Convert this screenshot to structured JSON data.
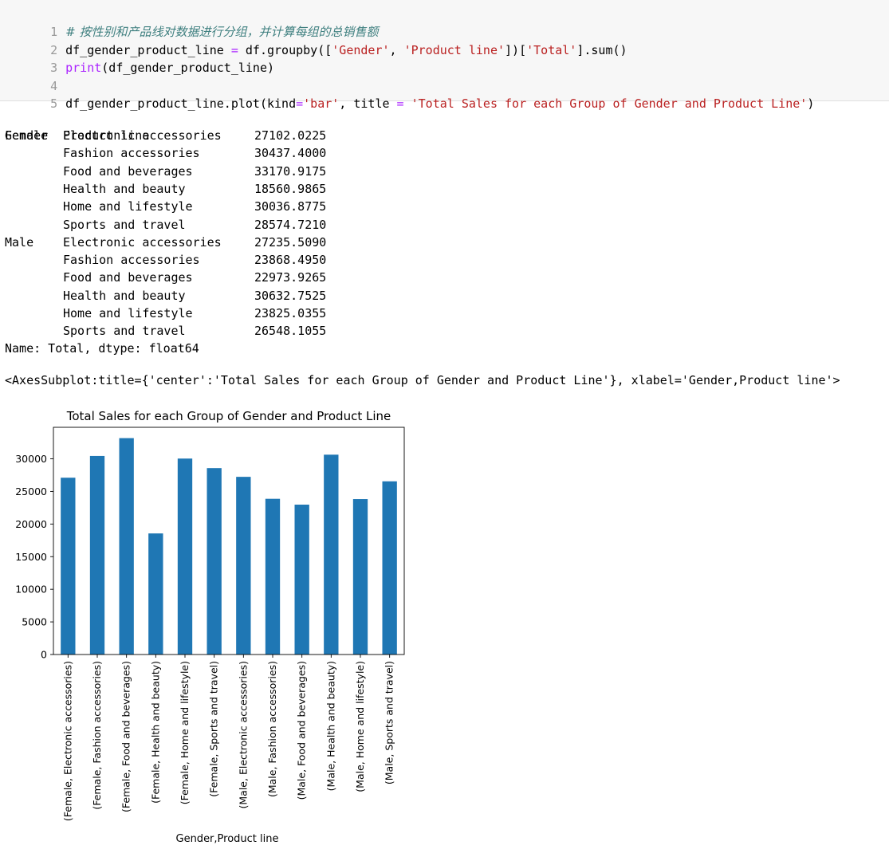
{
  "code_cell": {
    "line_numbers": [
      "1",
      "2",
      "3",
      "4",
      "5"
    ],
    "line1_comment": "# 按性别和产品线对数据进行分组，并计算每组的总销售额",
    "line2": {
      "a": "df_gender_product_line",
      "b": " = ",
      "c": "df.groupby([",
      "d": "'Gender'",
      "e": ", ",
      "f": "'Product line'",
      "g": "])[",
      "h": "'Total'",
      "i": "].sum()"
    },
    "line3": {
      "a": "print",
      "b": "(df_gender_product_line)"
    },
    "line5": {
      "a": "df_gender_product_line.plot(kind",
      "b": "=",
      "c": "'bar'",
      "d": ", title ",
      "e": "=",
      "f": " ",
      "g": "'Total Sales for each Group of Gender and Product Line'",
      "h": ")"
    }
  },
  "output": {
    "header_gender": "Gender",
    "header_product_line": "Product line",
    "rows": [
      {
        "gender": "Female",
        "product_line": "Electronic accessories",
        "value": "27102.0225"
      },
      {
        "gender": "",
        "product_line": "Fashion accessories",
        "value": "30437.4000"
      },
      {
        "gender": "",
        "product_line": "Food and beverages",
        "value": "33170.9175"
      },
      {
        "gender": "",
        "product_line": "Health and beauty",
        "value": "18560.9865"
      },
      {
        "gender": "",
        "product_line": "Home and lifestyle",
        "value": "30036.8775"
      },
      {
        "gender": "",
        "product_line": "Sports and travel",
        "value": "28574.7210"
      },
      {
        "gender": "Male",
        "product_line": "Electronic accessories",
        "value": "27235.5090"
      },
      {
        "gender": "",
        "product_line": "Fashion accessories",
        "value": "23868.4950"
      },
      {
        "gender": "",
        "product_line": "Food and beverages",
        "value": "22973.9265"
      },
      {
        "gender": "",
        "product_line": "Health and beauty",
        "value": "30632.7525"
      },
      {
        "gender": "",
        "product_line": "Home and lifestyle",
        "value": "23825.0355"
      },
      {
        "gender": "",
        "product_line": "Sports and travel",
        "value": "26548.1055"
      }
    ],
    "footer": "Name: Total, dtype: float64",
    "axes_repr": "<AxesSubplot:title={'center':'Total Sales for each Group of Gender and Product Line'}, xlabel='Gender,Product line'>"
  },
  "chart_data": {
    "type": "bar",
    "title": "Total Sales for each Group of Gender and Product Line",
    "xlabel": "Gender,Product line",
    "ylabel": "",
    "categories": [
      "(Female, Electronic accessories)",
      "(Female, Fashion accessories)",
      "(Female, Food and beverages)",
      "(Female, Health and beauty)",
      "(Female, Home and lifestyle)",
      "(Female, Sports and travel)",
      "(Male, Electronic accessories)",
      "(Male, Fashion accessories)",
      "(Male, Food and beverages)",
      "(Male, Health and beauty)",
      "(Male, Home and lifestyle)",
      "(Male, Sports and travel)"
    ],
    "values": [
      27102.0225,
      30437.4,
      33170.9175,
      18560.9865,
      30036.8775,
      28574.721,
      27235.509,
      23868.495,
      22973.9265,
      30632.7525,
      23825.0355,
      26548.1055
    ],
    "yticks": [
      0,
      5000,
      10000,
      15000,
      20000,
      25000,
      30000
    ],
    "ytick_labels": [
      "0",
      "5000",
      "10000",
      "15000",
      "20000",
      "25000",
      "30000"
    ],
    "ylim": [
      0,
      34829
    ],
    "bar_color": "#1f77b4",
    "grid": false,
    "legend": "none"
  }
}
